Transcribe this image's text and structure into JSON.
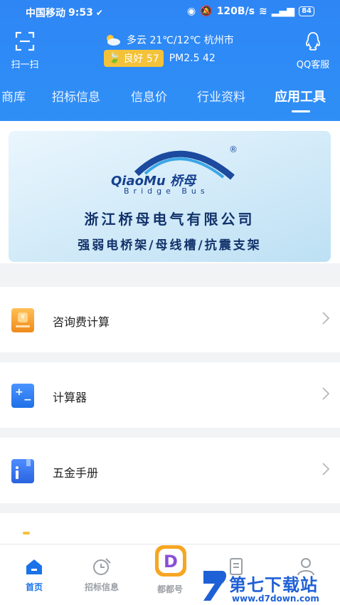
{
  "status": {
    "carrier": "中国移动",
    "time": "9:53",
    "speed": "120B/s",
    "battery": "84"
  },
  "header": {
    "scan_label": "扫一扫",
    "weather_text": "多云 21℃/12℃ 杭州市",
    "aqi_label": "良好 57",
    "pm_text": "PM2.5 42",
    "service_label": "QQ客服",
    "accent": "#2f8ff6",
    "aqi_color": "#f4c23a"
  },
  "tabs": [
    {
      "label": "商库"
    },
    {
      "label": "招标信息"
    },
    {
      "label": "信息价"
    },
    {
      "label": "行业资料"
    },
    {
      "label": "应用工具"
    }
  ],
  "banner": {
    "brand": "QiaoMu 桥母",
    "brand_sub": "Bridge Bus",
    "company": "浙江桥母电气有限公司",
    "slogan": "强弱电桥架/母线槽/抗震支架"
  },
  "tools": [
    {
      "label": "咨询费计算",
      "icon": "fee-calculator-icon",
      "color": "#f39a2b"
    },
    {
      "label": "计算器",
      "icon": "calculator-icon",
      "color": "#2f7ff0"
    },
    {
      "label": "五金手册",
      "icon": "manual-book-icon",
      "color": "#3b7ff2"
    }
  ],
  "bottom_nav": [
    {
      "label": "首页",
      "icon": "home-icon"
    },
    {
      "label": "招标信息",
      "icon": "bid-icon"
    },
    {
      "label": "都都号",
      "icon": "dudu-icon"
    },
    {
      "label": "",
      "icon": "document-icon"
    },
    {
      "label": "",
      "icon": "profile-icon"
    }
  ],
  "watermark": {
    "title": "第七下载站",
    "url": "www.d7down.com"
  }
}
